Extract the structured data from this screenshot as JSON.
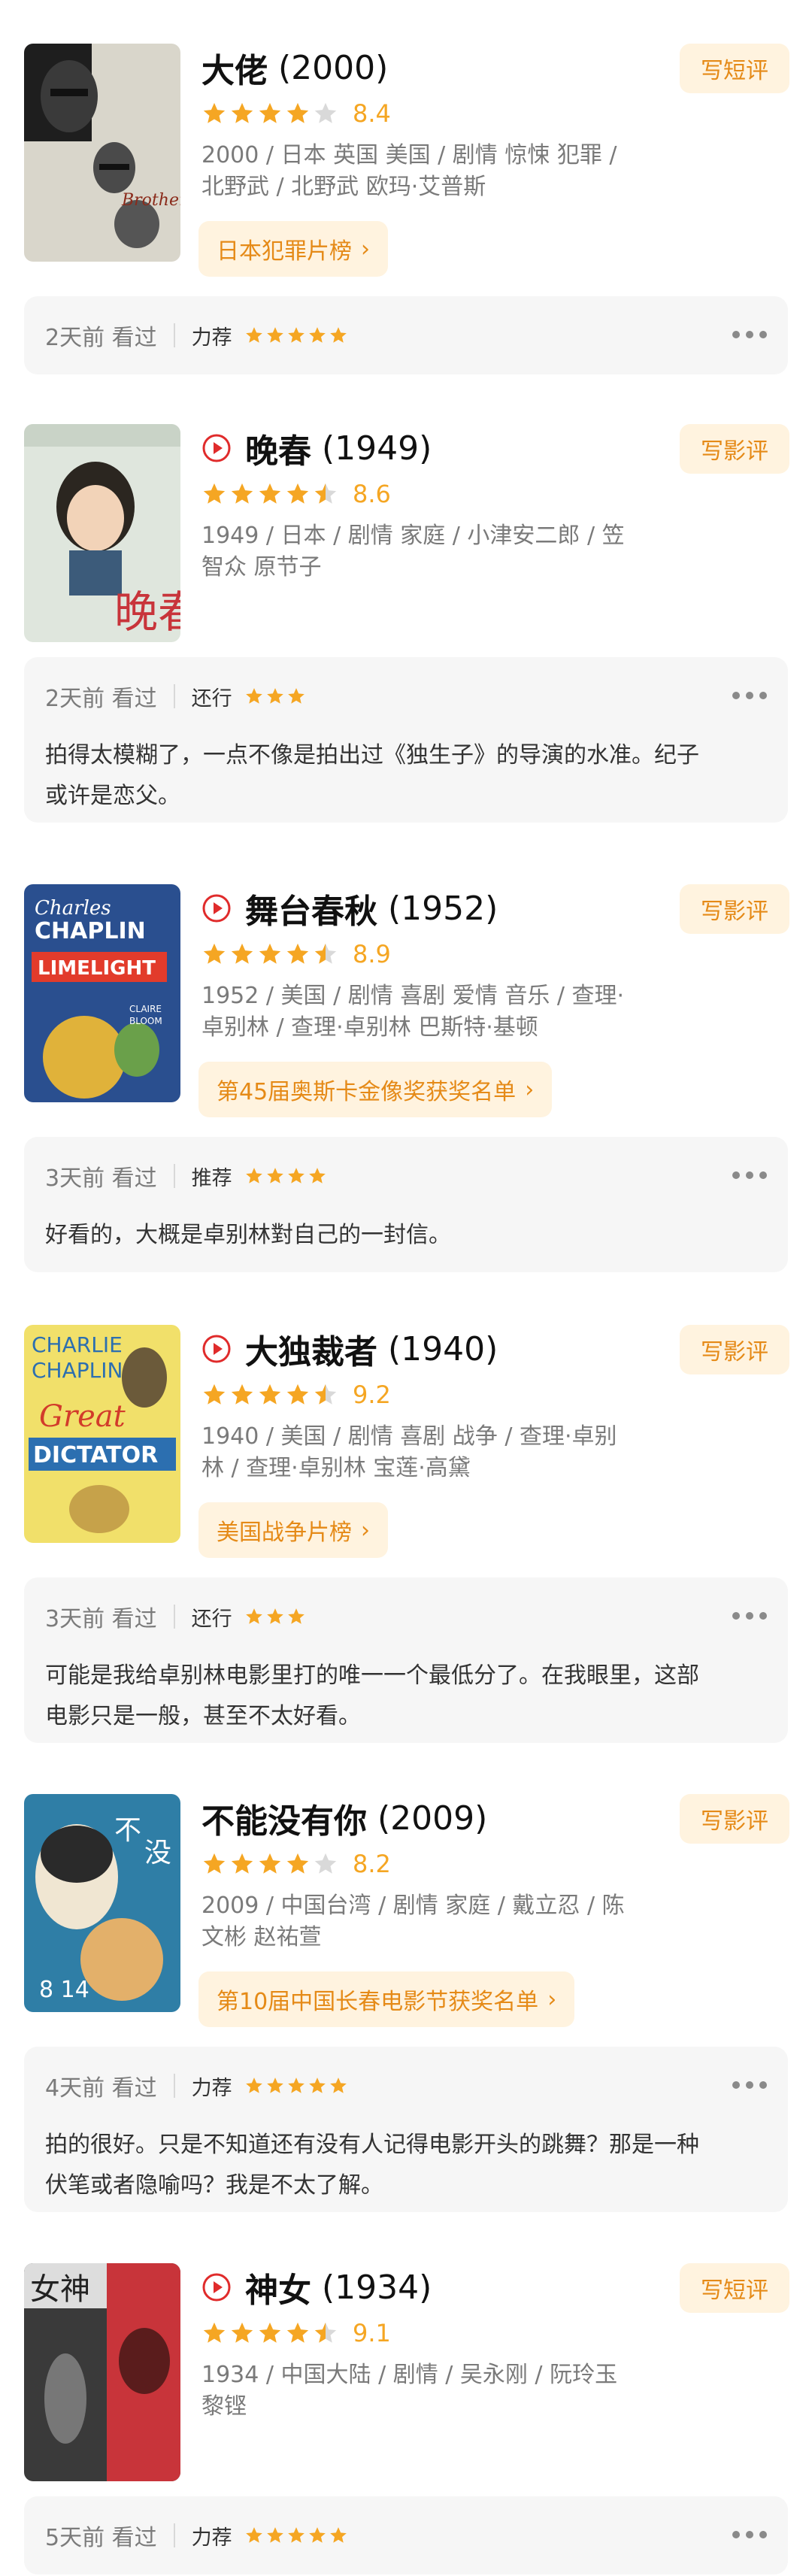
{
  "colors": {
    "accent_orange": "#e58a17",
    "chip_bg": "#fff3df",
    "star": "#f5a623",
    "star_empty": "#d9d9d9",
    "play_red": "#e02b2b",
    "card_bg": "#f6f6f6"
  },
  "movies": [
    {
      "title": "大佬",
      "year": "(2000)",
      "has_play": false,
      "rating": "8.4",
      "stars_display": 4,
      "meta_lines": [
        "2000 / 日本 英国 美国 / 剧情 惊悚 犯罪 /",
        "北野武 / 北野武 欧玛·艾普斯"
      ],
      "write_label": "写短评",
      "chart_link": "日本犯罪片榜",
      "watched": "2天前 看过",
      "verdict": "力荐",
      "user_stars": 5,
      "comment": ""
    },
    {
      "title": "晚春",
      "year": "(1949)",
      "has_play": true,
      "rating": "8.6",
      "stars_display": 4.5,
      "meta_lines": [
        "1949 / 日本 / 剧情 家庭 / 小津安二郎 / 笠",
        "智众 原节子"
      ],
      "write_label": "写影评",
      "chart_link": "",
      "watched": "2天前 看过",
      "verdict": "还行",
      "user_stars": 3,
      "comment_lines": [
        "拍得太模糊了，一点不像是拍出过《独生子》的导演的水准。纪子",
        "或许是恋父。"
      ]
    },
    {
      "title": "舞台春秋",
      "year": "(1952)",
      "has_play": true,
      "rating": "8.9",
      "stars_display": 4.5,
      "meta_lines": [
        "1952 / 美国 / 剧情 喜剧 爱情 音乐 / 查理·",
        "卓别林 / 查理·卓别林 巴斯特·基顿"
      ],
      "write_label": "写影评",
      "chart_link": "第45届奥斯卡金像奖获奖名单",
      "watched": "3天前 看过",
      "verdict": "推荐",
      "user_stars": 4,
      "comment_lines": [
        "好看的，大概是卓别林對自己的一封信。"
      ]
    },
    {
      "title": "大独裁者",
      "year": "(1940)",
      "has_play": true,
      "rating": "9.2",
      "stars_display": 4.5,
      "meta_lines": [
        "1940 / 美国 / 剧情 喜剧 战争 / 查理·卓别",
        "林 / 查理·卓别林 宝莲·高黛"
      ],
      "write_label": "写影评",
      "chart_link": "美国战争片榜",
      "watched": "3天前 看过",
      "verdict": "还行",
      "user_stars": 3,
      "comment_lines": [
        "可能是我给卓别林电影里打的唯一一个最低分了。在我眼里，这部",
        "电影只是一般，甚至不太好看。"
      ]
    },
    {
      "title": "不能没有你",
      "year": "(2009)",
      "has_play": false,
      "rating": "8.2",
      "stars_display": 4,
      "meta_lines": [
        "2009 / 中国台湾 / 剧情 家庭 / 戴立忍 / 陈",
        "文彬 赵祐萱"
      ],
      "write_label": "写影评",
      "chart_link": "第10届中国长春电影节获奖名单",
      "watched": "4天前 看过",
      "verdict": "力荐",
      "user_stars": 5,
      "comment_lines": [
        "拍的很好。只是不知道还有没有人记得电影开头的跳舞？那是一种",
        "伏笔或者隐喻吗？我是不太了解。"
      ]
    },
    {
      "title": "神女",
      "year": "(1934)",
      "has_play": true,
      "rating": "9.1",
      "stars_display": 4.5,
      "meta_lines": [
        "1934 / 中国大陆 / 剧情 / 吴永刚 / 阮玲玉",
        "黎铿"
      ],
      "write_label": "写短评",
      "chart_link": "",
      "watched": "5天前 看过",
      "verdict": "力荐",
      "user_stars": 5,
      "comment": ""
    }
  ]
}
